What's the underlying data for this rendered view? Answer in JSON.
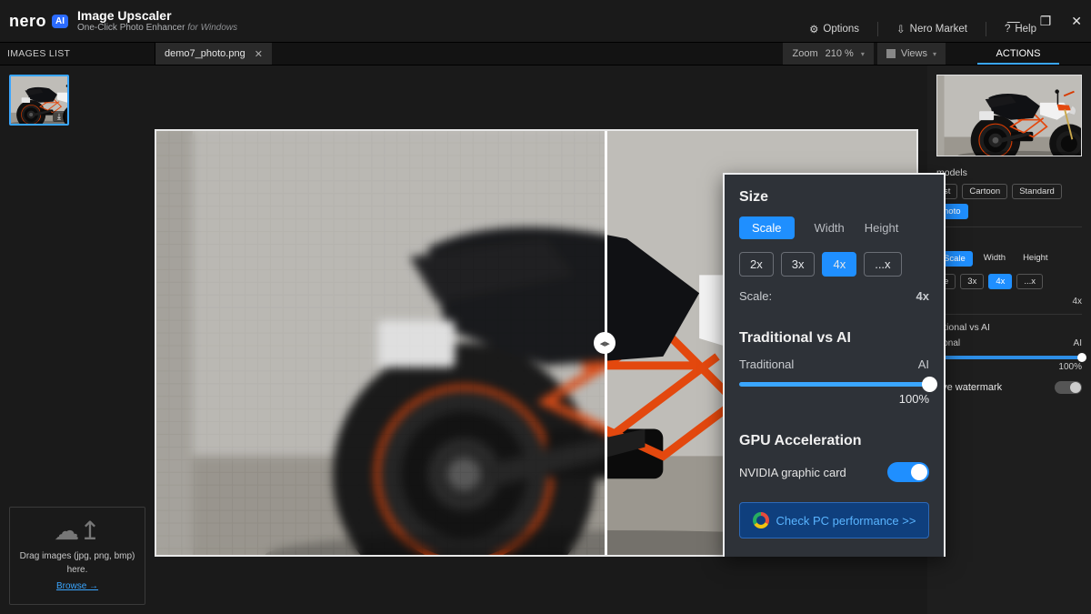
{
  "brand": "nero",
  "ai_badge": "AI",
  "app_title": "Image Upscaler",
  "app_sub": "One-Click Photo Enhancer",
  "app_sub_em": "for Windows",
  "menu": {
    "options": "Options",
    "market": "Nero Market",
    "help": "Help",
    "help_q": "?"
  },
  "images_list_label": "IMAGES LIST",
  "open_file": "demo7_photo.png",
  "zoom_label": "Zoom",
  "zoom_value": "210 %",
  "views_label": "Views",
  "actions_tab": "ACTIONS",
  "dropzone": {
    "line": "Drag images (jpg, png, bmp) here.",
    "browse": "Browse →"
  },
  "right": {
    "models_label": "models",
    "models": [
      "st",
      "Cartoon",
      "Standard",
      "hoto"
    ],
    "size_label": "e",
    "size_tabs": [
      "Scale",
      "Width",
      "Height"
    ],
    "size_presets": [
      "e",
      "3x",
      "4x",
      "...x"
    ],
    "scale_row_label": "e:",
    "scale_row_val": "4x",
    "trad_label": "ditional vs AI",
    "trad_l": "itional",
    "trad_r": "AI",
    "trad_pct": "100%",
    "watermark": "ove watermark"
  },
  "popup": {
    "size": "Size",
    "tabs": [
      "Scale",
      "Width",
      "Height"
    ],
    "presets": [
      "2x",
      "3x",
      "4x",
      "...x"
    ],
    "scale_label": "Scale:",
    "scale_val": "4x",
    "trad_title": "Traditional vs AI",
    "trad_l": "Traditional",
    "trad_r": "AI",
    "trad_pct": "100%",
    "gpu_title": "GPU Acceleration",
    "gpu_label": "NVIDIA graphic card",
    "perf": "Check PC performance >>"
  }
}
